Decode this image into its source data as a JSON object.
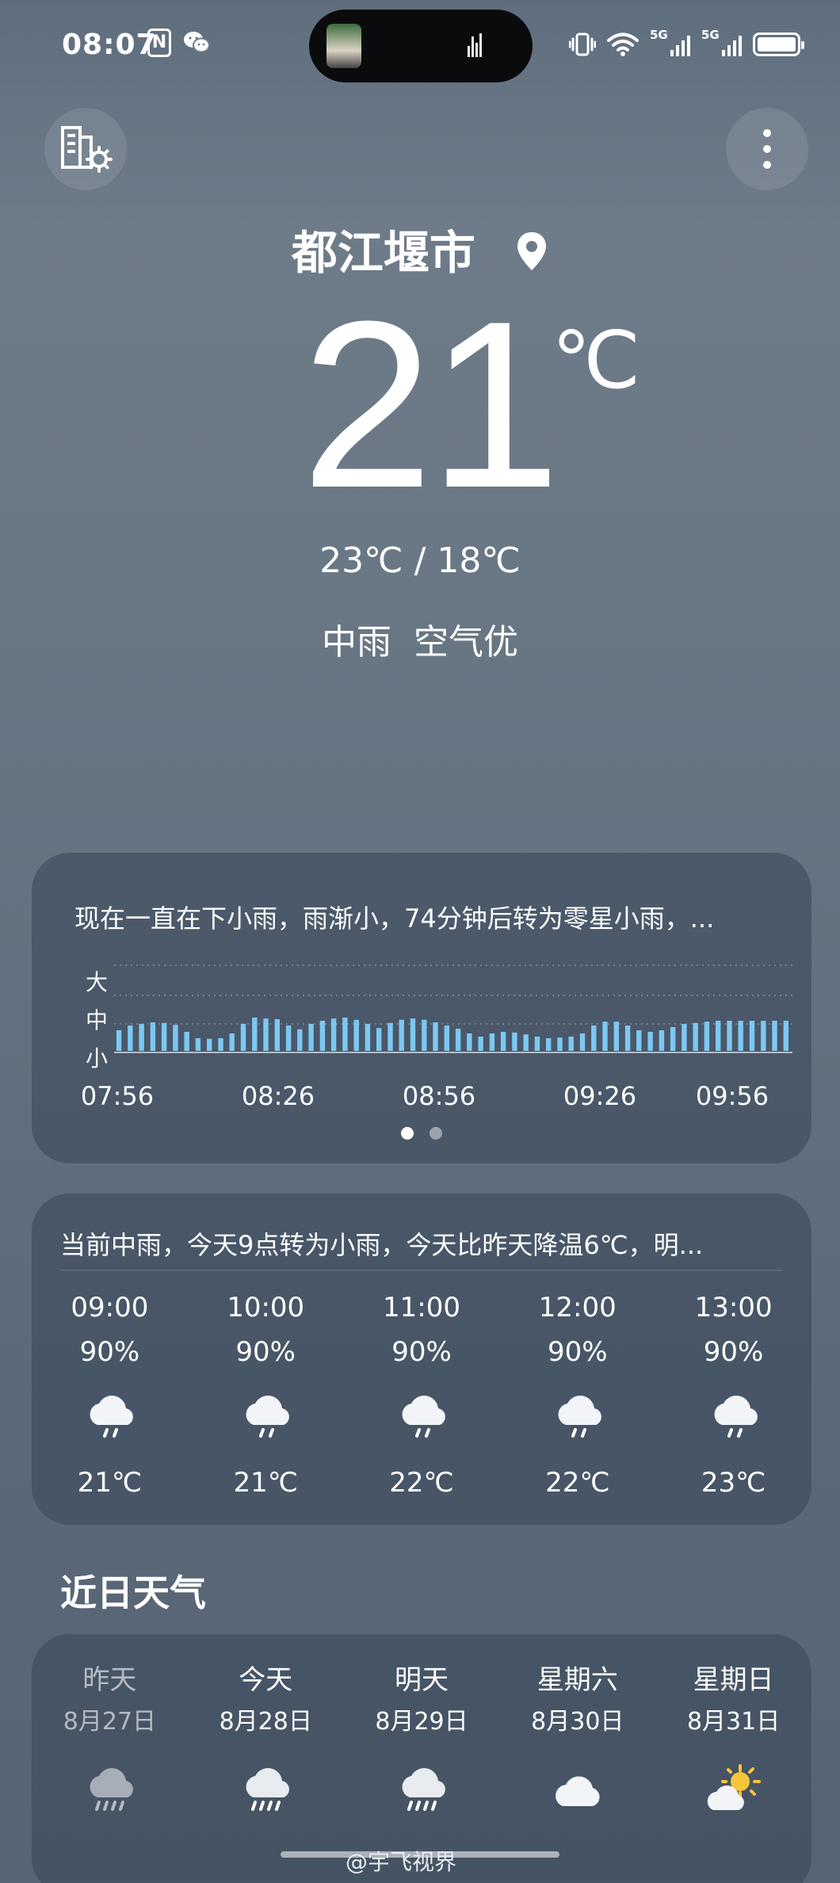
{
  "status_bar": {
    "time": "08:07",
    "nfc": "N",
    "network1": "5G",
    "network2": "5G"
  },
  "header": {
    "city": "都江堰市",
    "temperature": "21",
    "unit": "℃",
    "high_low": "23℃ / 18℃",
    "condition": "中雨",
    "air_quality": "空气优"
  },
  "rain_card": {
    "summary": "现在一直在下小雨，雨渐小，74分钟后转为零星小雨，...",
    "levels": [
      "大",
      "中",
      "小"
    ],
    "times": [
      "07:56",
      "08:26",
      "08:56",
      "09:26",
      "09:56"
    ],
    "intensity": [
      0.55,
      0.7,
      0.75,
      0.8,
      0.78,
      0.72,
      0.5,
      0.3,
      0.28,
      0.3,
      0.45,
      0.75,
      0.95,
      0.92,
      0.9,
      0.7,
      0.58,
      0.75,
      0.85,
      0.92,
      0.95,
      0.88,
      0.75,
      0.62,
      0.78,
      0.88,
      0.92,
      0.88,
      0.8,
      0.7,
      0.6,
      0.45,
      0.35,
      0.45,
      0.5,
      0.48,
      0.42,
      0.35,
      0.3,
      0.32,
      0.35,
      0.45,
      0.7,
      0.82,
      0.82,
      0.7,
      0.55,
      0.5,
      0.55,
      0.65,
      0.75,
      0.78,
      0.82,
      0.85,
      0.85,
      0.85,
      0.85,
      0.85,
      0.85,
      0.85
    ],
    "pages": 2,
    "active_page": 0
  },
  "hourly_card": {
    "summary": "当前中雨，今天9点转为小雨，今天比昨天降温6℃，明...",
    "hours": [
      {
        "time": "09:00",
        "precip": "90%",
        "icon": "light-rain-icon",
        "temp": "21℃"
      },
      {
        "time": "10:00",
        "precip": "90%",
        "icon": "light-rain-icon",
        "temp": "21℃"
      },
      {
        "time": "11:00",
        "precip": "90%",
        "icon": "light-rain-icon",
        "temp": "22℃"
      },
      {
        "time": "12:00",
        "precip": "90%",
        "icon": "light-rain-icon",
        "temp": "22℃"
      },
      {
        "time": "13:00",
        "precip": "90%",
        "icon": "light-rain-icon",
        "temp": "23℃"
      }
    ]
  },
  "daily_section": {
    "title": "近日天气",
    "days": [
      {
        "name": "昨天",
        "date": "8月27日",
        "icon": "moderate-rain-icon"
      },
      {
        "name": "今天",
        "date": "8月28日",
        "icon": "moderate-rain-icon"
      },
      {
        "name": "明天",
        "date": "8月29日",
        "icon": "moderate-rain-icon"
      },
      {
        "name": "星期六",
        "date": "8月30日",
        "icon": "cloudy-icon"
      },
      {
        "name": "星期日",
        "date": "8月31日",
        "icon": "partly-cloudy-icon"
      }
    ]
  },
  "watermark": "@宇飞视界",
  "colors": {
    "rain_bar": "#7cc8f2",
    "dot_active": "#ffffff",
    "dot_inactive": "rgba(255,255,255,0.45)",
    "sun": "#f6c63b"
  }
}
